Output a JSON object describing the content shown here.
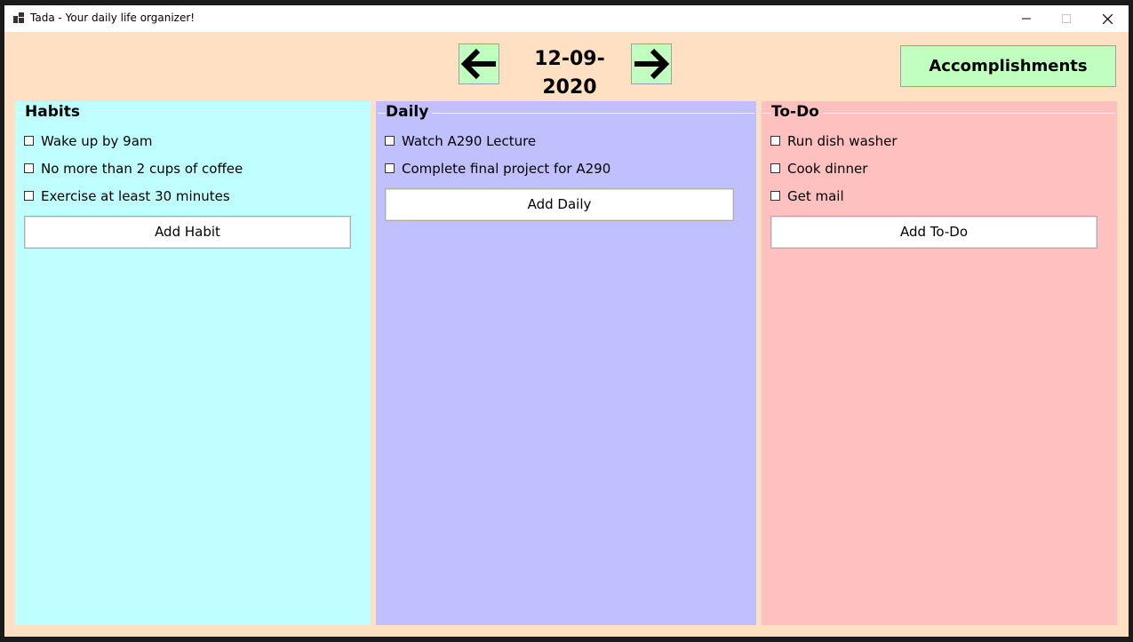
{
  "window": {
    "title": "Tada - Your daily life organizer!",
    "controls": [
      "minimize-icon",
      "maximize-icon",
      "close-icon"
    ]
  },
  "header": {
    "date": "12-09-2020",
    "prev_icon": "arrow-left-icon",
    "next_icon": "arrow-right-icon",
    "accomplishments_label": "Accomplishments"
  },
  "colors": {
    "window_bg": "#ffe0c2",
    "button_green": "#c0ffc0",
    "habits_bg": "#c0ffff",
    "daily_bg": "#c0c0ff",
    "todo_bg": "#ffc0c0"
  },
  "habits": {
    "title": "Habits",
    "items": [
      {
        "label": "Wake up by 9am",
        "checked": false
      },
      {
        "label": "No more than 2 cups of coffee",
        "checked": false
      },
      {
        "label": "Exercise at least 30 minutes",
        "checked": false
      }
    ],
    "add_label": "Add Habit"
  },
  "daily": {
    "title": "Daily",
    "items": [
      {
        "label": "Watch A290 Lecture",
        "checked": false
      },
      {
        "label": "Complete final project for A290",
        "checked": false
      }
    ],
    "add_label": "Add Daily"
  },
  "todo": {
    "title": "To-Do",
    "items": [
      {
        "label": "Run dish washer",
        "checked": false
      },
      {
        "label": "Cook dinner",
        "checked": false
      },
      {
        "label": "Get mail",
        "checked": false
      }
    ],
    "add_label": "Add To-Do"
  }
}
